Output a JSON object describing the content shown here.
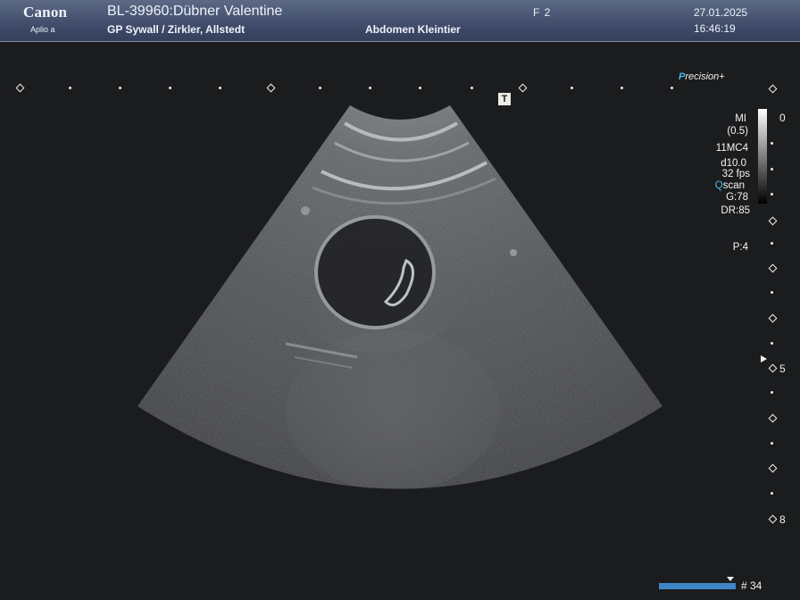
{
  "header": {
    "brand": "Canon",
    "model": "Aplio a",
    "patient": "BL-39960:Dübner Valentine",
    "doctor": "GP Sywall / Zirkler, Allstedt",
    "preset": "Abdomen Kleintier",
    "frame": "F   2",
    "date": "27.01.2025",
    "time": "16:46:19"
  },
  "overlay": {
    "precision_p": "P",
    "precision_rest": "recision+",
    "t_marker": "T",
    "mi": "MI",
    "mi_value": "(0.5)",
    "probe": "11MC4",
    "depth": "d10.0",
    "fps": "32 fps",
    "qscan_q": "Q",
    "qscan_rest": "scan",
    "gain": "G:78",
    "dynamic_range": "DR:85",
    "p_value": "P:4"
  },
  "depth_scale": {
    "top": "0",
    "mid": "5",
    "bottom": "8"
  },
  "cine": {
    "frame_index": "# 34"
  }
}
